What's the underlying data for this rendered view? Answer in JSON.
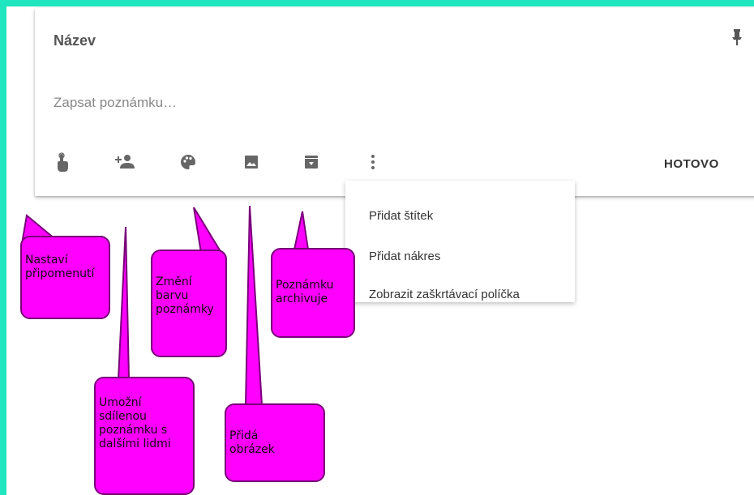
{
  "note": {
    "title": "Název",
    "placeholder": "Zapsat poznámku…",
    "done_label": "HOTOVO"
  },
  "toolbar": {
    "icons": [
      "touch-reminder-icon",
      "add-collaborator-icon",
      "palette-icon",
      "image-icon",
      "archive-icon",
      "more-vert-icon"
    ]
  },
  "menu": {
    "items": [
      "Přidat štítek",
      "Přidat nákres",
      "Zobrazit zaškrtávací políčka"
    ]
  },
  "callouts": {
    "reminder": [
      "Nastaví",
      "připomenutí"
    ],
    "collaborator": [
      "Umožní",
      "sdílenou",
      "poznámku s",
      "dalšími lidmi"
    ],
    "color": [
      "Změní",
      "barvu",
      "poznámky"
    ],
    "image": [
      "Přidá",
      "obrázek"
    ],
    "archive": [
      "Poznámku",
      "archivuje"
    ]
  },
  "colors": {
    "frame": "#1fe6c0",
    "callout": "#ff00ff",
    "callout_border": "#7a007a"
  }
}
